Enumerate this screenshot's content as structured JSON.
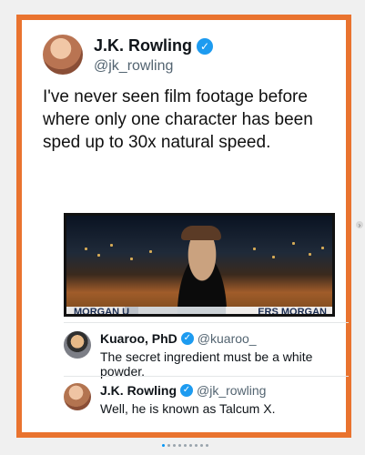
{
  "main_post": {
    "author_name": "J.K. Rowling",
    "handle": "@jk_rowling",
    "text": "I've never seen film footage before where only one character has been sped up to 30x natural speed."
  },
  "video": {
    "overlay_left": "MORGAN U",
    "overlay_right": "ERS MORGAN"
  },
  "replies": [
    {
      "author_name": "Kuaroo, PhD",
      "handle": "@kuaroo_",
      "text": "The secret ingredient must be a white powder."
    },
    {
      "author_name": "J.K. Rowling",
      "handle": "@jk_rowling",
      "text": "Well, he is known as Talcum X."
    }
  ],
  "carousel": {
    "dot_count": 9,
    "active_index": 0
  },
  "colors": {
    "frame": "#e9732f",
    "verified": "#1d9bf0",
    "active_dot": "#0095f6"
  },
  "icons": {
    "verified": "verified-badge-icon",
    "next": "chevron-right-icon"
  }
}
